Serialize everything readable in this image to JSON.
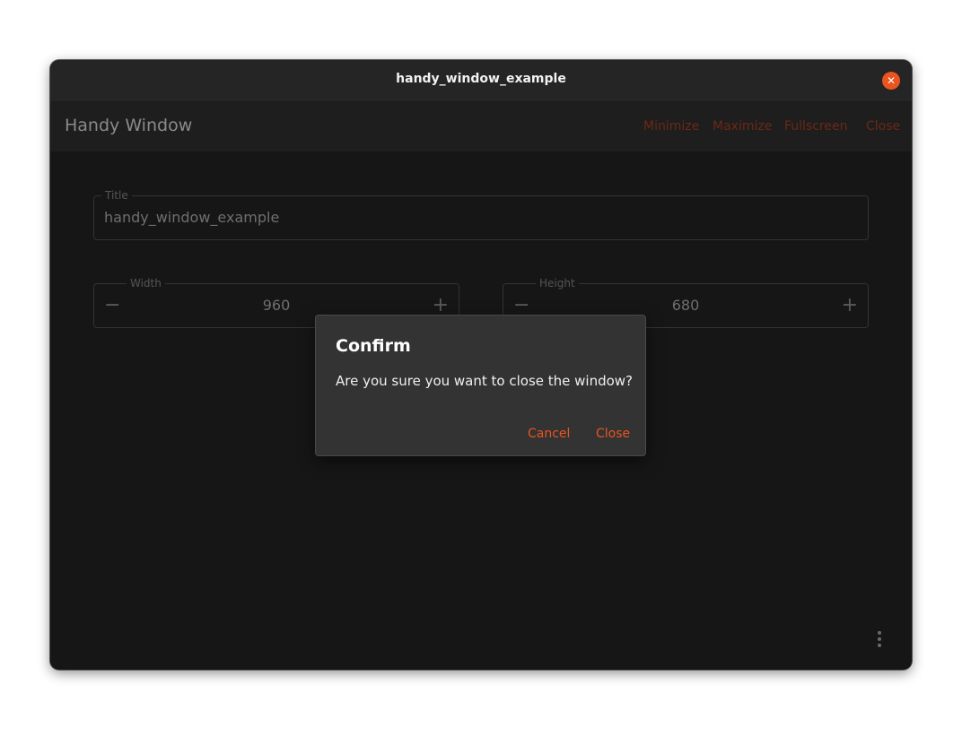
{
  "window": {
    "title": "handy_window_example",
    "close_glyph": "✕"
  },
  "appbar": {
    "title": "Handy Window",
    "actions": {
      "minimize": "Minimize",
      "maximize": "Maximize",
      "fullscreen": "Fullscreen",
      "close": "Close"
    }
  },
  "form": {
    "title": {
      "label": "Title",
      "value": "handy_window_example"
    },
    "width": {
      "label": "Width",
      "value": "960",
      "decrement": "−",
      "increment": "+"
    },
    "height": {
      "label": "Height",
      "value": "680",
      "decrement": "−",
      "increment": "+"
    }
  },
  "dialog": {
    "title": "Confirm",
    "message": "Are you sure you want to close the window?",
    "cancel_label": "Cancel",
    "close_label": "Close"
  },
  "icons": {
    "window_close": "close-icon",
    "overflow": "more-vert-icon"
  },
  "colors": {
    "accent": "#e95420",
    "accent_dimmed": "#6b2813",
    "background": "#161616"
  }
}
